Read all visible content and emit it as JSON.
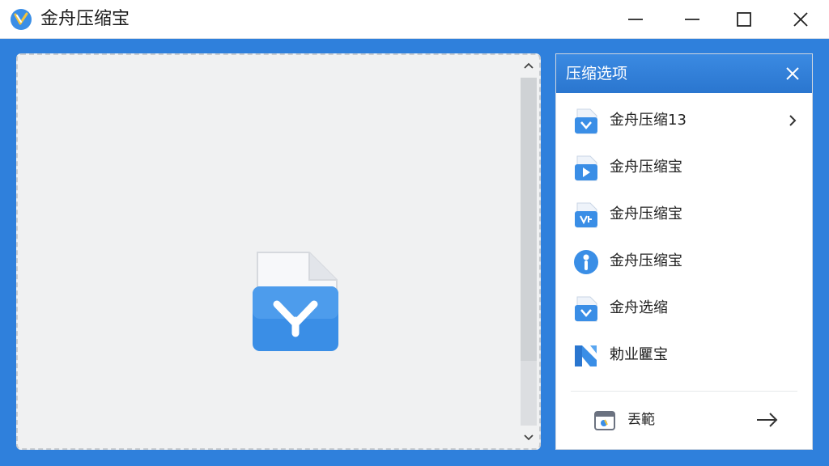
{
  "window": {
    "title": "金舟压缩宝",
    "controls": [
      "minimize-icon",
      "maximize-icon",
      "restore-icon",
      "close-icon"
    ]
  },
  "drop_area": {
    "file_icon": "compressed-file-icon",
    "scroll": [
      "chevron-up-icon",
      "chevron-down-icon"
    ]
  },
  "panel": {
    "title": "压缩选项",
    "close_icon": "close-icon",
    "items": [
      {
        "label": "金舟压缩13",
        "icon": "compress-file-icon",
        "has_arrow": true
      },
      {
        "label": "金舟压缩宝",
        "icon": "video-file-icon",
        "has_arrow": false
      },
      {
        "label": "金舟压缩宝",
        "icon": "compress-file-icon",
        "has_arrow": false
      },
      {
        "label": "金舟压缩宝",
        "icon": "info-icon",
        "has_arrow": false
      },
      {
        "label": "金舟选缩",
        "icon": "compress-file-icon",
        "has_arrow": false
      },
      {
        "label": "勅业匷宝",
        "icon": "brand-logo-icon",
        "has_arrow": false
      }
    ],
    "footer": {
      "label": "丟範",
      "icon": "calendar-icon",
      "arrow_icon": "arrow-right-icon"
    }
  },
  "colors": {
    "frame": "#2f80dc",
    "panel_header": "#2a76cf",
    "icon_blue": "#3a8ee6"
  }
}
